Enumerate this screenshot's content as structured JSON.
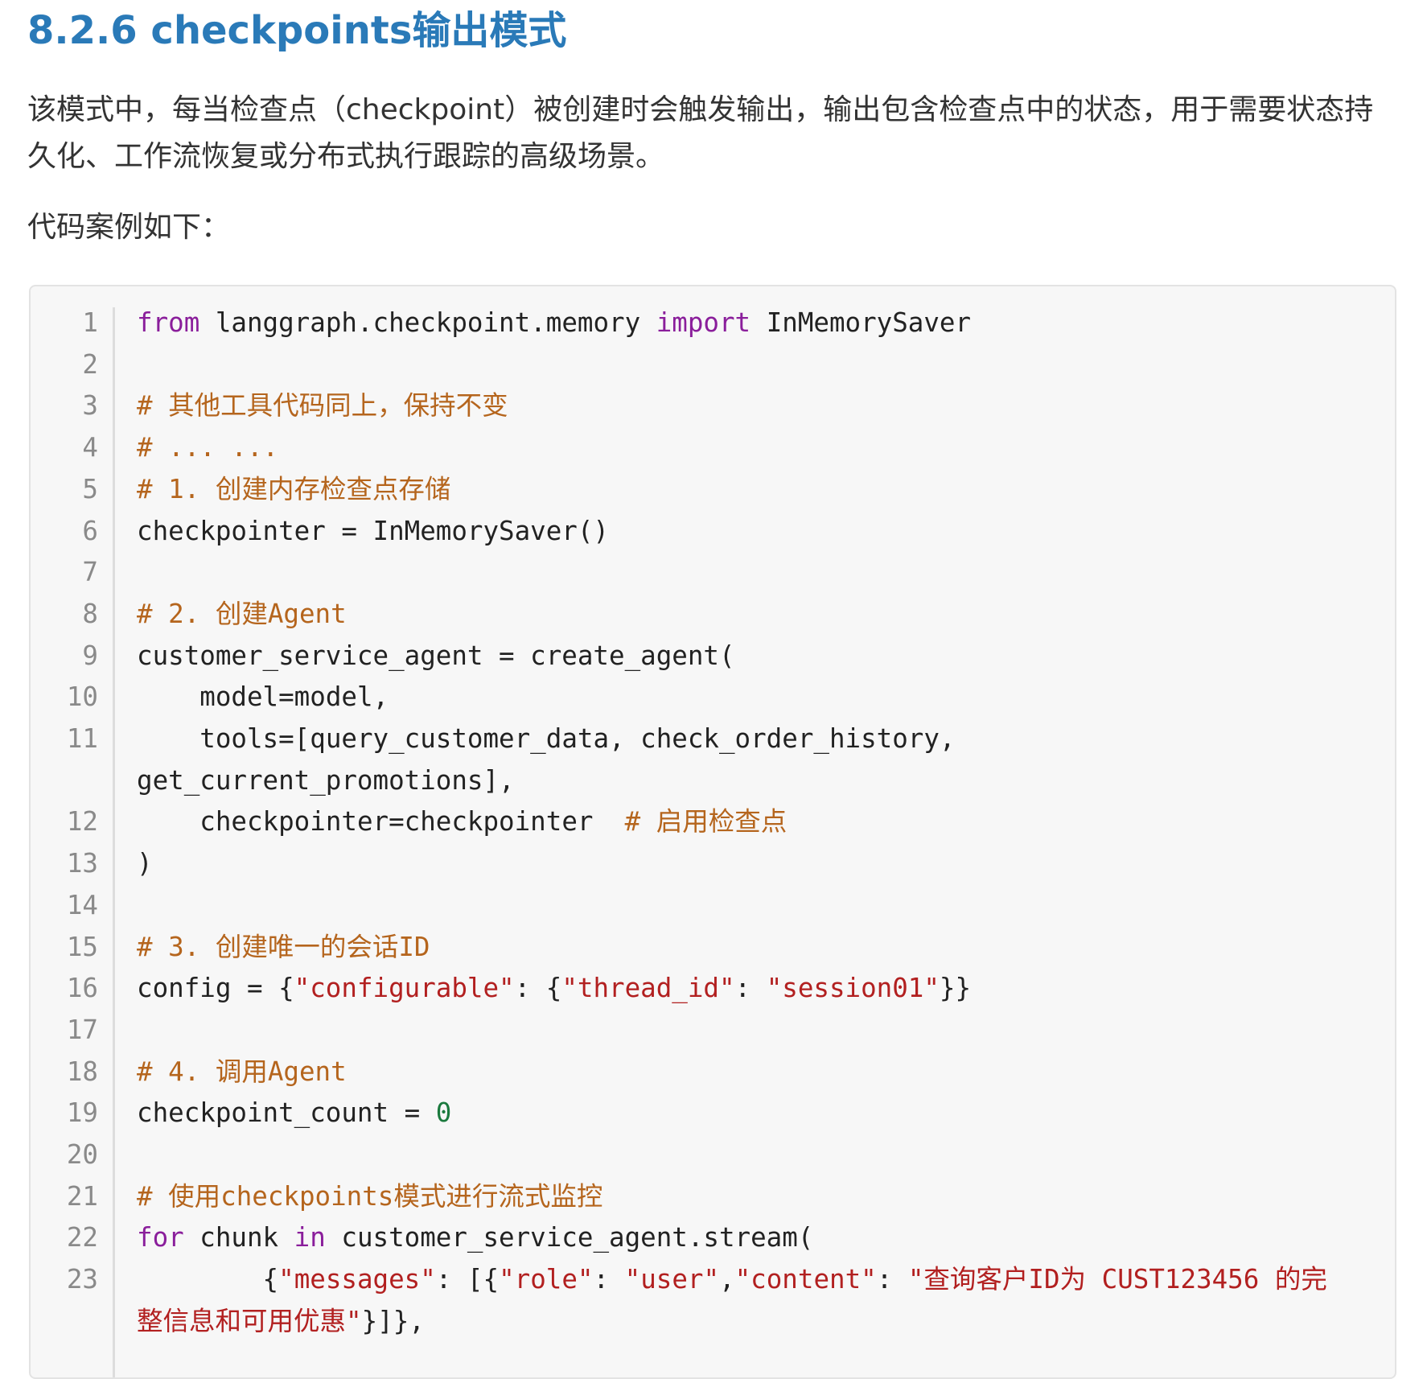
{
  "heading": "8.2.6 checkpoints输出模式",
  "paragraphs": [
    "该模式中，每当检查点（checkpoint）被创建时会触发输出，输出包含检查点中的状态，用于需要状态持久化、工作流恢复或分布式执行跟踪的高级场景。",
    "代码案例如下："
  ],
  "code": {
    "language": "python",
    "lines": [
      {
        "n": "1",
        "tokens": [
          {
            "t": "kw",
            "v": "from"
          },
          {
            "t": "tx",
            "v": " langgraph.checkpoint.memory "
          },
          {
            "t": "kw",
            "v": "import"
          },
          {
            "t": "tx",
            "v": " InMemorySaver"
          }
        ]
      },
      {
        "n": "2",
        "tokens": []
      },
      {
        "n": "3",
        "tokens": [
          {
            "t": "cm",
            "v": "# 其他工具代码同上，保持不变"
          }
        ]
      },
      {
        "n": "4",
        "tokens": [
          {
            "t": "cm",
            "v": "# ... ..."
          }
        ]
      },
      {
        "n": "5",
        "tokens": [
          {
            "t": "cm",
            "v": "# 1. 创建内存检查点存储"
          }
        ]
      },
      {
        "n": "6",
        "tokens": [
          {
            "t": "tx",
            "v": "checkpointer = InMemorySaver()"
          }
        ]
      },
      {
        "n": "7",
        "tokens": []
      },
      {
        "n": "8",
        "tokens": [
          {
            "t": "cm",
            "v": "# 2. 创建Agent"
          }
        ]
      },
      {
        "n": "9",
        "tokens": [
          {
            "t": "tx",
            "v": "customer_service_agent = create_agent("
          }
        ]
      },
      {
        "n": "10",
        "tokens": [
          {
            "t": "tx",
            "v": "    model=model,"
          }
        ]
      },
      {
        "n": "11",
        "tokens": [
          {
            "t": "tx",
            "v": "    tools=[query_customer_data, check_order_history, get_current_promotions],"
          }
        ]
      },
      {
        "n": "12",
        "tokens": [
          {
            "t": "tx",
            "v": "    checkpointer=checkpointer  "
          },
          {
            "t": "cm",
            "v": "# 启用检查点"
          }
        ]
      },
      {
        "n": "13",
        "tokens": [
          {
            "t": "tx",
            "v": ")"
          }
        ]
      },
      {
        "n": "14",
        "tokens": []
      },
      {
        "n": "15",
        "tokens": [
          {
            "t": "cm",
            "v": "# 3. 创建唯一的会话ID"
          }
        ]
      },
      {
        "n": "16",
        "tokens": [
          {
            "t": "tx",
            "v": "config = {"
          },
          {
            "t": "st",
            "v": "\"configurable\""
          },
          {
            "t": "tx",
            "v": ": {"
          },
          {
            "t": "st",
            "v": "\"thread_id\""
          },
          {
            "t": "tx",
            "v": ": "
          },
          {
            "t": "st",
            "v": "\"session01\""
          },
          {
            "t": "tx",
            "v": "}}"
          }
        ]
      },
      {
        "n": "17",
        "tokens": []
      },
      {
        "n": "18",
        "tokens": [
          {
            "t": "cm",
            "v": "# 4. 调用Agent"
          }
        ]
      },
      {
        "n": "19",
        "tokens": [
          {
            "t": "tx",
            "v": "checkpoint_count = "
          },
          {
            "t": "nm",
            "v": "0"
          }
        ]
      },
      {
        "n": "20",
        "tokens": []
      },
      {
        "n": "21",
        "tokens": [
          {
            "t": "cm",
            "v": "# 使用checkpoints模式进行流式监控"
          }
        ]
      },
      {
        "n": "22",
        "tokens": [
          {
            "t": "kw",
            "v": "for"
          },
          {
            "t": "tx",
            "v": " chunk "
          },
          {
            "t": "kw",
            "v": "in"
          },
          {
            "t": "tx",
            "v": " customer_service_agent.stream("
          }
        ]
      },
      {
        "n": "23",
        "tokens": [
          {
            "t": "tx",
            "v": "        {"
          },
          {
            "t": "st",
            "v": "\"messages\""
          },
          {
            "t": "tx",
            "v": ": [{"
          },
          {
            "t": "st",
            "v": "\"role\""
          },
          {
            "t": "tx",
            "v": ": "
          },
          {
            "t": "st",
            "v": "\"user\""
          },
          {
            "t": "tx",
            "v": ","
          },
          {
            "t": "st",
            "v": "\"content\""
          },
          {
            "t": "tx",
            "v": ": "
          },
          {
            "t": "st",
            "v": "\"查询客户ID为 CUST123456 的完整信息和可用优惠\""
          },
          {
            "t": "tx",
            "v": "}]},"
          }
        ]
      }
    ]
  }
}
